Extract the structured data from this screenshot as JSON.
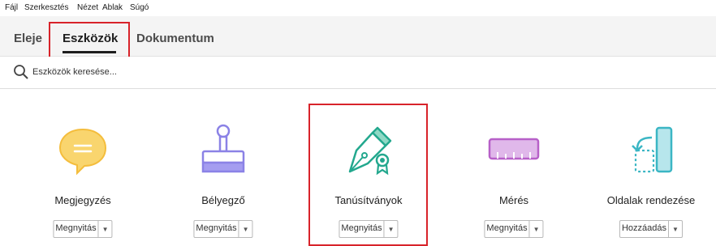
{
  "menu": [
    "Fájl",
    "Szerkesztés",
    "Nézet",
    "Ablak",
    "Súgó"
  ],
  "tabs": [
    {
      "label": "Eleje",
      "active": false
    },
    {
      "label": "Eszközök",
      "active": true
    },
    {
      "label": "Dokumentum",
      "active": false
    }
  ],
  "search": {
    "placeholder": "Eszközök keresése...",
    "icon": "search-icon"
  },
  "tools": [
    {
      "label": "Megjegyzés",
      "action": "Megnyitás",
      "icon": "comment-icon",
      "color": "#f6c142"
    },
    {
      "label": "Bélyegző",
      "action": "Megnyitás",
      "icon": "stamp-icon",
      "color": "#8b82e6"
    },
    {
      "label": "Tanúsítványok",
      "action": "Megnyitás",
      "icon": "certificate-pen-icon",
      "color": "#23a88e"
    },
    {
      "label": "Mérés",
      "action": "Megnyitás",
      "icon": "ruler-icon",
      "color": "#b760c8"
    },
    {
      "label": "Oldalak rendezése",
      "action": "Hozzáadás",
      "icon": "organize-pages-icon",
      "color": "#3bb6c4"
    }
  ],
  "colors": {
    "highlight": "#d8232a",
    "tab_bg": "#f4f4f4"
  }
}
